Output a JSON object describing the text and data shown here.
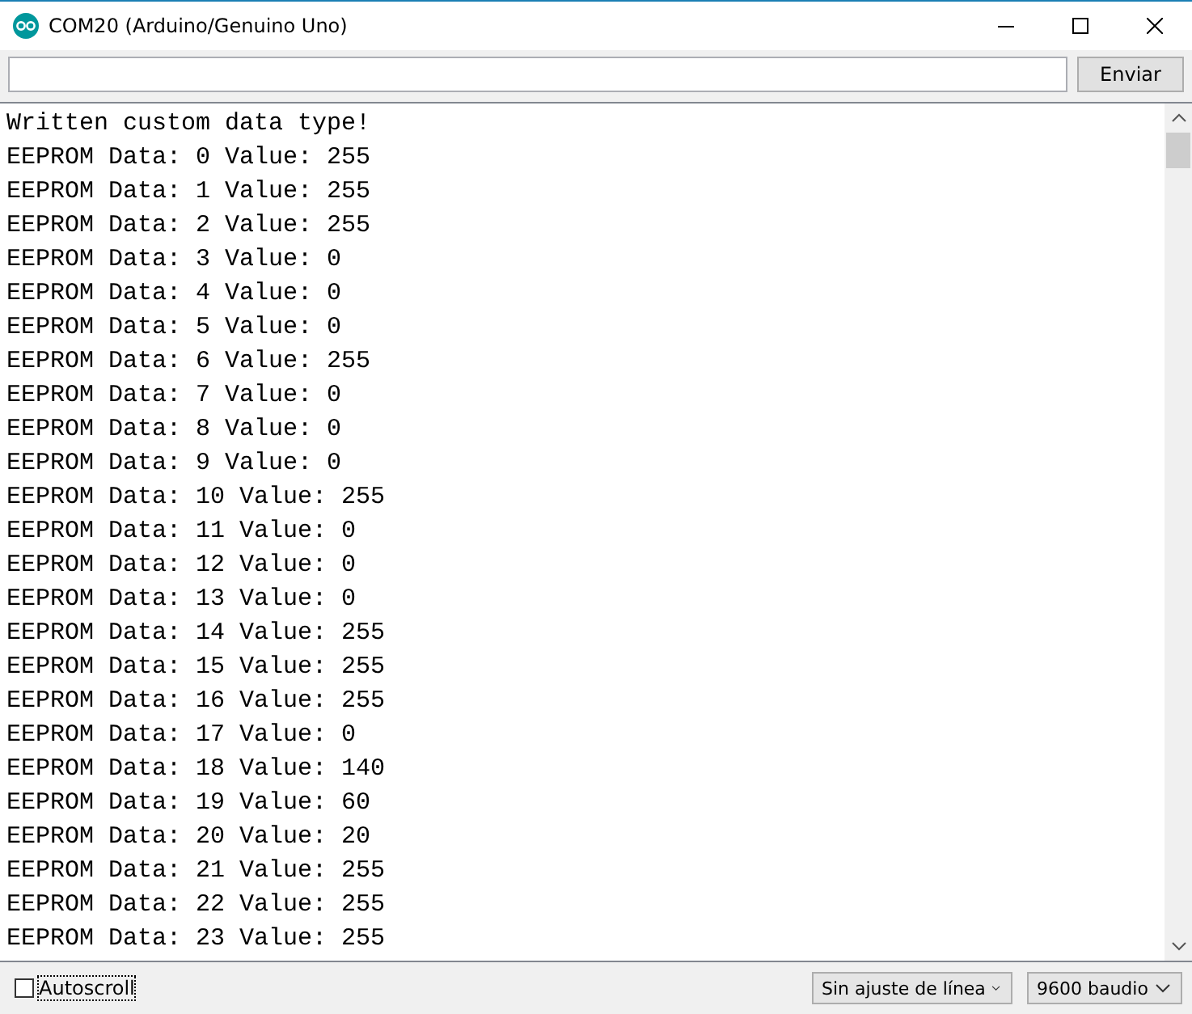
{
  "window": {
    "title": "COM20 (Arduino/Genuino Uno)"
  },
  "send": {
    "button": "Enviar"
  },
  "output": [
    "Written custom data type!",
    "EEPROM Data: 0 Value: 255",
    "EEPROM Data: 1 Value: 255",
    "EEPROM Data: 2 Value: 255",
    "EEPROM Data: 3 Value: 0",
    "EEPROM Data: 4 Value: 0",
    "EEPROM Data: 5 Value: 0",
    "EEPROM Data: 6 Value: 255",
    "EEPROM Data: 7 Value: 0",
    "EEPROM Data: 8 Value: 0",
    "EEPROM Data: 9 Value: 0",
    "EEPROM Data: 10 Value: 255",
    "EEPROM Data: 11 Value: 0",
    "EEPROM Data: 12 Value: 0",
    "EEPROM Data: 13 Value: 0",
    "EEPROM Data: 14 Value: 255",
    "EEPROM Data: 15 Value: 255",
    "EEPROM Data: 16 Value: 255",
    "EEPROM Data: 17 Value: 0",
    "EEPROM Data: 18 Value: 140",
    "EEPROM Data: 19 Value: 60",
    "EEPROM Data: 20 Value: 20",
    "EEPROM Data: 21 Value: 255",
    "EEPROM Data: 22 Value: 255",
    "EEPROM Data: 23 Value: 255"
  ],
  "autoscroll": {
    "label": "Autoscroll",
    "checked": false
  },
  "line_ending": "Sin ajuste de línea",
  "baud": "9600 baudio"
}
